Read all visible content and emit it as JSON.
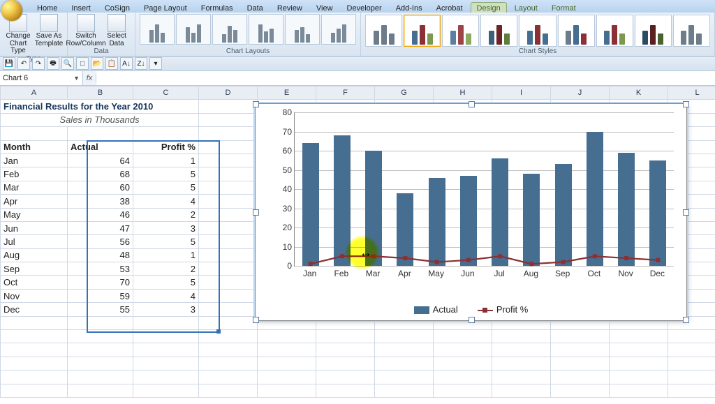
{
  "tabs": {
    "main": [
      "Home",
      "Insert",
      "CoSign",
      "Page Layout",
      "Formulas",
      "Data",
      "Review",
      "View",
      "Developer",
      "Add-Ins",
      "Acrobat"
    ],
    "contextual": [
      "Design",
      "Layout",
      "Format"
    ],
    "active": "Design"
  },
  "ribbon": {
    "type_group": "Type",
    "change_type": "Change Chart Type",
    "save_template": "Save As Template",
    "data_group": "Data",
    "switch_rc": "Switch Row/Column",
    "select_data": "Select Data",
    "layouts_group": "Chart Layouts",
    "styles_group": "Chart Styles"
  },
  "namebox": "Chart 6",
  "fx_label": "fx",
  "columns": [
    "A",
    "B",
    "C",
    "D",
    "E",
    "F",
    "G",
    "H",
    "I",
    "J",
    "K",
    "L"
  ],
  "cells": {
    "title": "Financial Results for the Year 2010",
    "subtitle": "Sales in Thousands",
    "h_month": "Month",
    "h_actual": "Actual",
    "h_profit": "Profit %"
  },
  "rows": [
    {
      "m": "Jan",
      "a": 64,
      "p": 1
    },
    {
      "m": "Feb",
      "a": 68,
      "p": 5
    },
    {
      "m": "Mar",
      "a": 60,
      "p": 5
    },
    {
      "m": "Apr",
      "a": 38,
      "p": 4
    },
    {
      "m": "May",
      "a": 46,
      "p": 2
    },
    {
      "m": "Jun",
      "a": 47,
      "p": 3
    },
    {
      "m": "Jul",
      "a": 56,
      "p": 5
    },
    {
      "m": "Aug",
      "a": 48,
      "p": 1
    },
    {
      "m": "Sep",
      "a": 53,
      "p": 2
    },
    {
      "m": "Oct",
      "a": 70,
      "p": 5
    },
    {
      "m": "Nov",
      "a": 59,
      "p": 4
    },
    {
      "m": "Dec",
      "a": 55,
      "p": 3
    }
  ],
  "chart_data": {
    "type": "bar+line",
    "categories": [
      "Jan",
      "Feb",
      "Mar",
      "Apr",
      "May",
      "Jun",
      "Jul",
      "Aug",
      "Sep",
      "Oct",
      "Nov",
      "Dec"
    ],
    "series": [
      {
        "name": "Actual",
        "type": "bar",
        "values": [
          64,
          68,
          60,
          38,
          46,
          47,
          56,
          48,
          53,
          70,
          59,
          55
        ]
      },
      {
        "name": "Profit %",
        "type": "line",
        "values": [
          1,
          5,
          5,
          4,
          2,
          3,
          5,
          1,
          2,
          5,
          4,
          3
        ]
      }
    ],
    "ylim": [
      0,
      80
    ],
    "ytick": 10,
    "legend": [
      "Actual",
      "Profit %"
    ]
  }
}
